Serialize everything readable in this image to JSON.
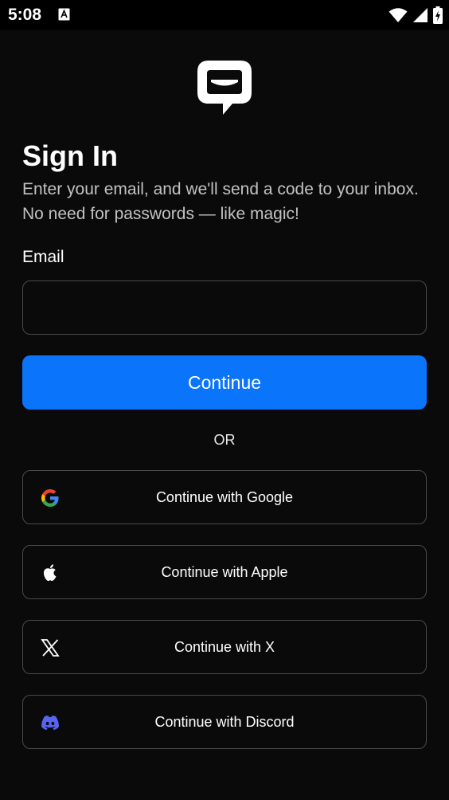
{
  "status_bar": {
    "time": "5:08"
  },
  "signin": {
    "title": "Sign In",
    "subtitle": "Enter your email, and we'll send a code to your inbox. No need for passwords — like magic!",
    "email_label": "Email",
    "email_value": "",
    "email_placeholder": "",
    "continue_label": "Continue",
    "or_label": "OR"
  },
  "social": [
    {
      "label": "Continue with Google",
      "icon": "google-icon"
    },
    {
      "label": "Continue with Apple",
      "icon": "apple-icon"
    },
    {
      "label": "Continue with X",
      "icon": "x-icon"
    },
    {
      "label": "Continue with Discord",
      "icon": "discord-icon"
    }
  ],
  "colors": {
    "background": "#0a0a0a",
    "primary": "#0a74fb",
    "border": "#4a4a4a",
    "discord": "#5865f2"
  }
}
